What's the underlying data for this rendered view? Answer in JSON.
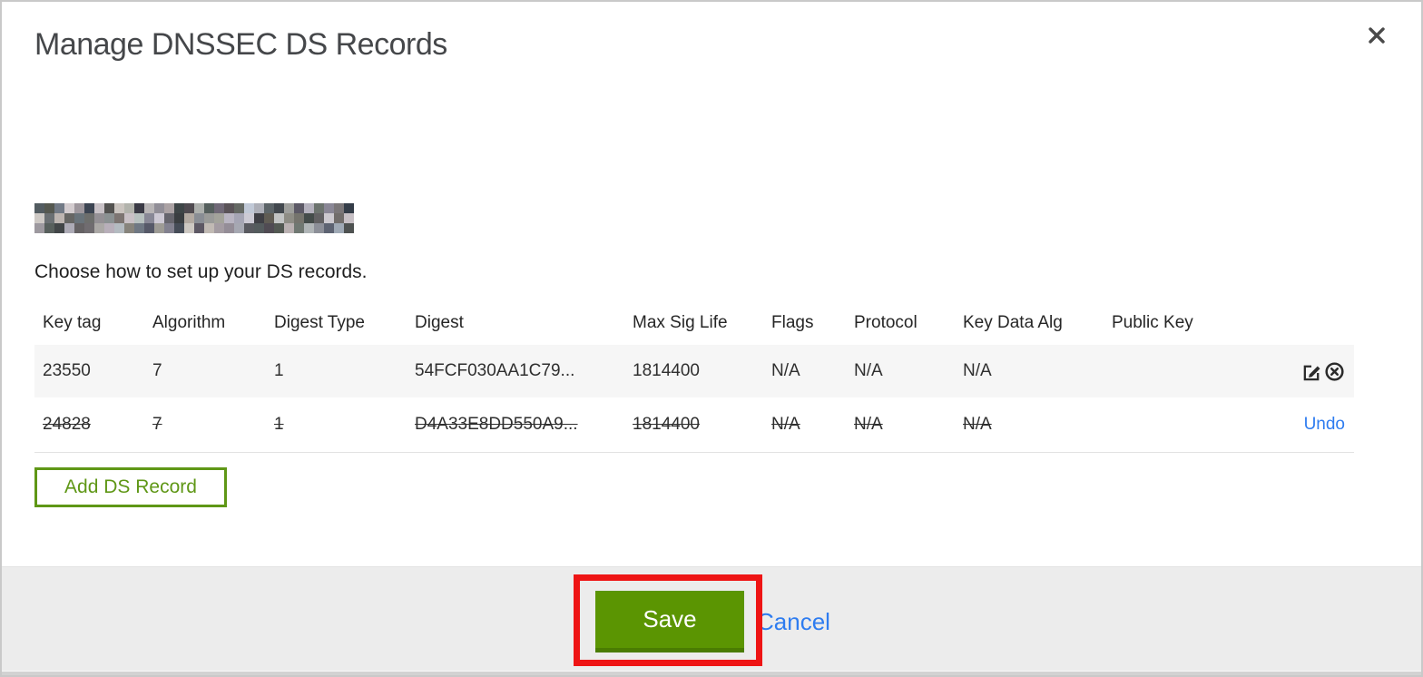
{
  "modal": {
    "title": "Manage DNSSEC DS Records",
    "instruction": "Choose how to set up your DS records.",
    "domain_redacted": true
  },
  "table": {
    "headers": [
      "Key tag",
      "Algorithm",
      "Digest Type",
      "Digest",
      "Max Sig Life",
      "Flags",
      "Protocol",
      "Key Data Alg",
      "Public Key"
    ],
    "rows": [
      {
        "cells": [
          "23550",
          "7",
          "1",
          "54FCF030AA1C79...",
          "1814400",
          "N/A",
          "N/A",
          "N/A",
          ""
        ],
        "deleted": false,
        "actions": [
          "edit",
          "delete"
        ]
      },
      {
        "cells": [
          "24828",
          "7",
          "1",
          "D4A33E8DD550A9...",
          "1814400",
          "N/A",
          "N/A",
          "N/A",
          ""
        ],
        "deleted": true,
        "actions": [
          "undo"
        ],
        "undo_label": "Undo"
      }
    ]
  },
  "buttons": {
    "add_ds_record": "Add DS Record",
    "save": "Save",
    "cancel": "Cancel"
  },
  "icons": {
    "close": "close-icon",
    "edit": "edit-record-icon",
    "delete": "delete-record-icon"
  },
  "annotation": {
    "type": "red-highlight-box",
    "target": "save-button"
  },
  "colors": {
    "save_green": "#5b9502",
    "save_green_edge": "#4a7c02",
    "outline_green": "#5f9716",
    "link_blue": "#2e7cf0",
    "annotation_red": "#ee1414",
    "footer_gray": "#ececec",
    "row_stripe_gray": "#f6f6f6"
  }
}
